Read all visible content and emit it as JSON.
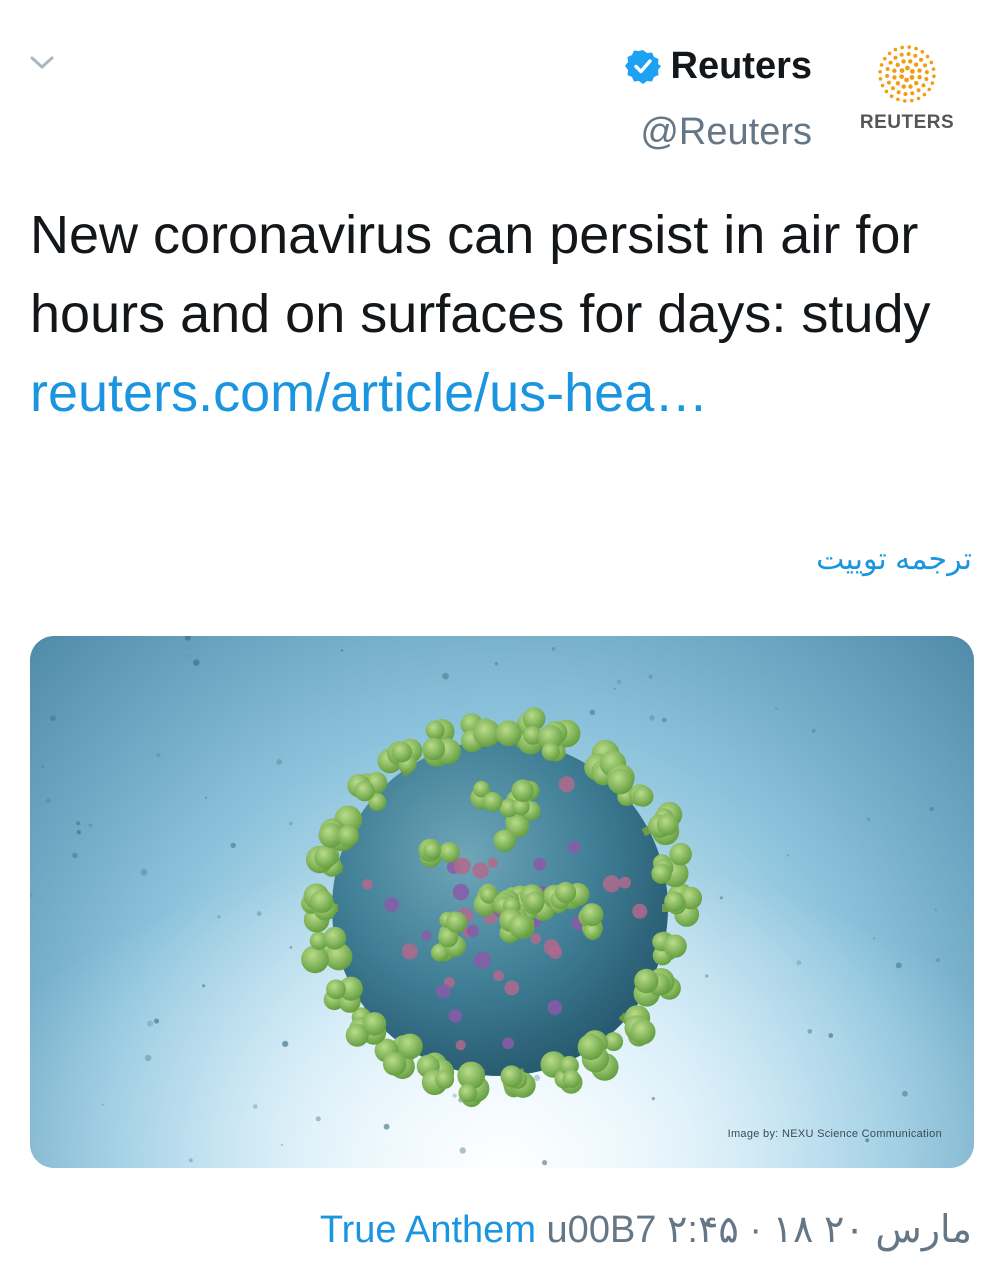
{
  "header": {
    "display_name": "Reuters",
    "handle": "@Reuters",
    "logo_text": "REUTERS",
    "icons": {
      "collapse": "chevron-down-icon",
      "verified": "verified-badge-icon",
      "logo": "reuters-logo-icon"
    }
  },
  "tweet": {
    "text": "New coronavirus can persist in air for hours and on surfaces for days: study ",
    "link": "reuters.com/article/us-hea…",
    "translate_label": "ترجمه توییت"
  },
  "media": {
    "alt": "3D rendering of coronavirus",
    "credit": "Image by: NEXU Science Communication"
  },
  "footer": {
    "source": "True Anthem",
    "separator": "u00B7",
    "date_time": "۲:۴۵ · ۱۸ مارس ۲۰"
  },
  "colors": {
    "link": "#1b95e0",
    "verified": "#1da1f2",
    "logo_orange": "#f39c12",
    "muted": "#657786"
  }
}
